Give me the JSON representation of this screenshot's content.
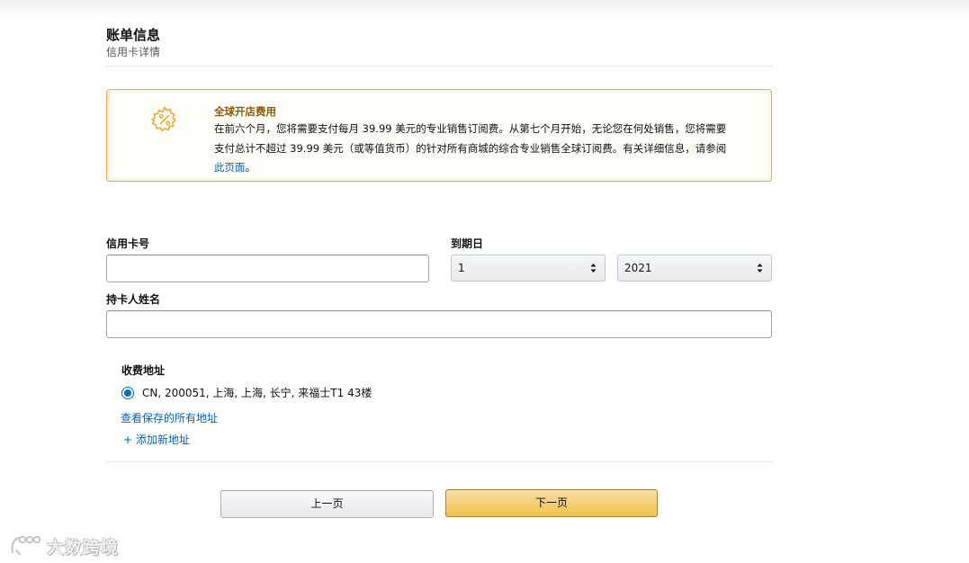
{
  "section": {
    "title": "账单信息",
    "subtitle": "信用卡详情"
  },
  "notice": {
    "icon": "gear-percent-icon",
    "title": "全球开店费用",
    "body": "在前六个月，您将需要支付每月 39.99 美元的专业销售订阅费。从第七个月开始，无论您在何处销售，您将需要支付总计不超过 39.99 美元（或等值货币）的针对所有商城的综合专业销售全球订阅费。有关详细信息，请参阅",
    "link_text": "此页面",
    "body_end": "。",
    "accent_color": "#f0a93a"
  },
  "form": {
    "card_number_label": "信用卡号",
    "card_number_value": "",
    "expiry_label": "到期日",
    "expiry_month": "1",
    "expiry_year": "2021",
    "holder_label": "持卡人姓名",
    "holder_value": ""
  },
  "billing": {
    "label": "收费地址",
    "address": "CN, 200051, 上海, 上海, 长宁, 来福士T1 43楼",
    "view_all_link": "查看保存的所有地址",
    "add_new_link": "+ 添加新地址"
  },
  "buttons": {
    "prev": "上一页",
    "next": "下一页"
  },
  "watermark": {
    "text": "大数跨境"
  }
}
